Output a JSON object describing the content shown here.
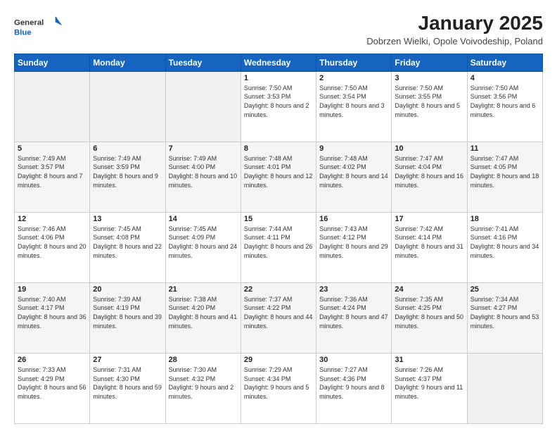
{
  "header": {
    "logo_general": "General",
    "logo_blue": "Blue",
    "main_title": "January 2025",
    "subtitle": "Dobrzen Wielki, Opole Voivodeship, Poland"
  },
  "weekdays": [
    "Sunday",
    "Monday",
    "Tuesday",
    "Wednesday",
    "Thursday",
    "Friday",
    "Saturday"
  ],
  "weeks": [
    [
      {
        "day": "",
        "info": ""
      },
      {
        "day": "",
        "info": ""
      },
      {
        "day": "",
        "info": ""
      },
      {
        "day": "1",
        "info": "Sunrise: 7:50 AM\nSunset: 3:53 PM\nDaylight: 8 hours and 2 minutes."
      },
      {
        "day": "2",
        "info": "Sunrise: 7:50 AM\nSunset: 3:54 PM\nDaylight: 8 hours and 3 minutes."
      },
      {
        "day": "3",
        "info": "Sunrise: 7:50 AM\nSunset: 3:55 PM\nDaylight: 8 hours and 5 minutes."
      },
      {
        "day": "4",
        "info": "Sunrise: 7:50 AM\nSunset: 3:56 PM\nDaylight: 8 hours and 6 minutes."
      }
    ],
    [
      {
        "day": "5",
        "info": "Sunrise: 7:49 AM\nSunset: 3:57 PM\nDaylight: 8 hours and 7 minutes."
      },
      {
        "day": "6",
        "info": "Sunrise: 7:49 AM\nSunset: 3:59 PM\nDaylight: 8 hours and 9 minutes."
      },
      {
        "day": "7",
        "info": "Sunrise: 7:49 AM\nSunset: 4:00 PM\nDaylight: 8 hours and 10 minutes."
      },
      {
        "day": "8",
        "info": "Sunrise: 7:48 AM\nSunset: 4:01 PM\nDaylight: 8 hours and 12 minutes."
      },
      {
        "day": "9",
        "info": "Sunrise: 7:48 AM\nSunset: 4:02 PM\nDaylight: 8 hours and 14 minutes."
      },
      {
        "day": "10",
        "info": "Sunrise: 7:47 AM\nSunset: 4:04 PM\nDaylight: 8 hours and 16 minutes."
      },
      {
        "day": "11",
        "info": "Sunrise: 7:47 AM\nSunset: 4:05 PM\nDaylight: 8 hours and 18 minutes."
      }
    ],
    [
      {
        "day": "12",
        "info": "Sunrise: 7:46 AM\nSunset: 4:06 PM\nDaylight: 8 hours and 20 minutes."
      },
      {
        "day": "13",
        "info": "Sunrise: 7:45 AM\nSunset: 4:08 PM\nDaylight: 8 hours and 22 minutes."
      },
      {
        "day": "14",
        "info": "Sunrise: 7:45 AM\nSunset: 4:09 PM\nDaylight: 8 hours and 24 minutes."
      },
      {
        "day": "15",
        "info": "Sunrise: 7:44 AM\nSunset: 4:11 PM\nDaylight: 8 hours and 26 minutes."
      },
      {
        "day": "16",
        "info": "Sunrise: 7:43 AM\nSunset: 4:12 PM\nDaylight: 8 hours and 29 minutes."
      },
      {
        "day": "17",
        "info": "Sunrise: 7:42 AM\nSunset: 4:14 PM\nDaylight: 8 hours and 31 minutes."
      },
      {
        "day": "18",
        "info": "Sunrise: 7:41 AM\nSunset: 4:16 PM\nDaylight: 8 hours and 34 minutes."
      }
    ],
    [
      {
        "day": "19",
        "info": "Sunrise: 7:40 AM\nSunset: 4:17 PM\nDaylight: 8 hours and 36 minutes."
      },
      {
        "day": "20",
        "info": "Sunrise: 7:39 AM\nSunset: 4:19 PM\nDaylight: 8 hours and 39 minutes."
      },
      {
        "day": "21",
        "info": "Sunrise: 7:38 AM\nSunset: 4:20 PM\nDaylight: 8 hours and 41 minutes."
      },
      {
        "day": "22",
        "info": "Sunrise: 7:37 AM\nSunset: 4:22 PM\nDaylight: 8 hours and 44 minutes."
      },
      {
        "day": "23",
        "info": "Sunrise: 7:36 AM\nSunset: 4:24 PM\nDaylight: 8 hours and 47 minutes."
      },
      {
        "day": "24",
        "info": "Sunrise: 7:35 AM\nSunset: 4:25 PM\nDaylight: 8 hours and 50 minutes."
      },
      {
        "day": "25",
        "info": "Sunrise: 7:34 AM\nSunset: 4:27 PM\nDaylight: 8 hours and 53 minutes."
      }
    ],
    [
      {
        "day": "26",
        "info": "Sunrise: 7:33 AM\nSunset: 4:29 PM\nDaylight: 8 hours and 56 minutes."
      },
      {
        "day": "27",
        "info": "Sunrise: 7:31 AM\nSunset: 4:30 PM\nDaylight: 8 hours and 59 minutes."
      },
      {
        "day": "28",
        "info": "Sunrise: 7:30 AM\nSunset: 4:32 PM\nDaylight: 9 hours and 2 minutes."
      },
      {
        "day": "29",
        "info": "Sunrise: 7:29 AM\nSunset: 4:34 PM\nDaylight: 9 hours and 5 minutes."
      },
      {
        "day": "30",
        "info": "Sunrise: 7:27 AM\nSunset: 4:36 PM\nDaylight: 9 hours and 8 minutes."
      },
      {
        "day": "31",
        "info": "Sunrise: 7:26 AM\nSunset: 4:37 PM\nDaylight: 9 hours and 11 minutes."
      },
      {
        "day": "",
        "info": ""
      }
    ]
  ]
}
